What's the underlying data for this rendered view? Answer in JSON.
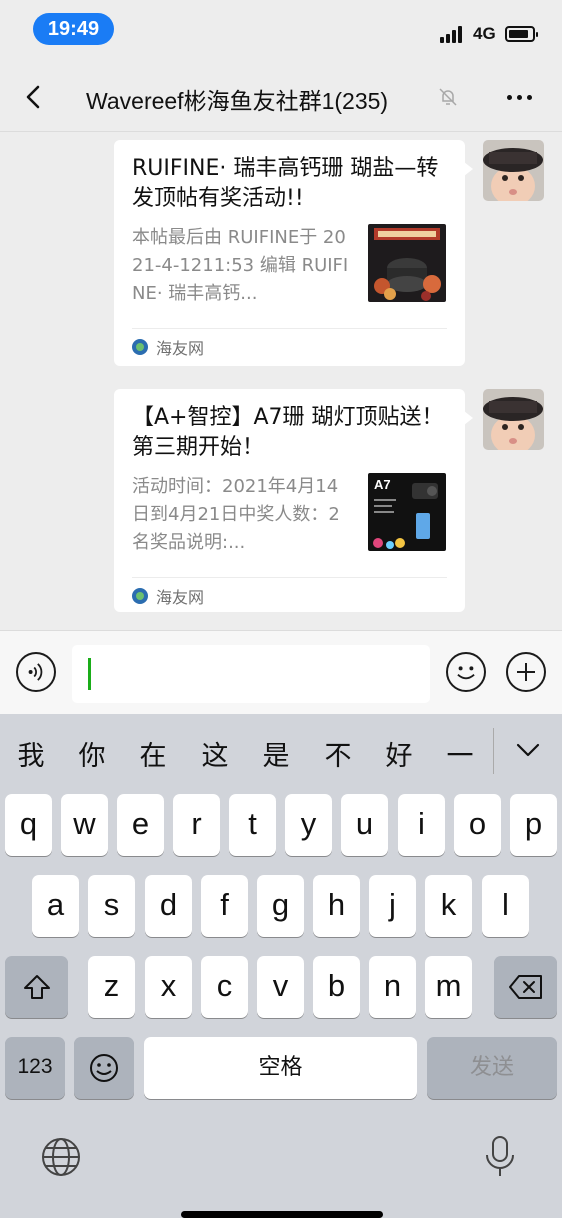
{
  "status_bar": {
    "time": "19:49",
    "network": "4G",
    "battery_level": 0.85
  },
  "nav": {
    "title": "Wavereef彬海鱼友社群1(235)"
  },
  "messages": [
    {
      "title": "RUIFINE· 瑞丰高钙珊 瑚盐—转发顶帖有奖活动!!",
      "description": "本帖最后由 RUIFINE于 2021-4-1211:53 编辑 RUIFINE· 瑞丰高钙...",
      "source": "海友网",
      "thumbnail_icon": "product-photo-thumbnail"
    },
    {
      "title": "【A+智控】A7珊 瑚灯顶贴送！第三期开始！",
      "description": "活动时间：2021年4月14日到4月21日中奖人数：2名奖品说明:...",
      "source": "海友网",
      "thumbnail_icon": "a7-light-thumbnail",
      "thumbnail_label": "A7"
    }
  ],
  "keyboard": {
    "candidates": [
      "我",
      "你",
      "在",
      "这",
      "是",
      "不",
      "好",
      "一"
    ],
    "row1": [
      "q",
      "w",
      "e",
      "r",
      "t",
      "y",
      "u",
      "i",
      "o",
      "p"
    ],
    "row2": [
      "a",
      "s",
      "d",
      "f",
      "g",
      "h",
      "j",
      "k",
      "l"
    ],
    "row3": [
      "z",
      "x",
      "c",
      "v",
      "b",
      "n",
      "m"
    ],
    "numbers_key": "123",
    "space_key": "空格",
    "send_key": "发送"
  },
  "colors": {
    "time_pill": "#1a7cf5",
    "caret": "#1aad19",
    "background": "#ededed",
    "keyboard_bg": "#d1d4da"
  }
}
